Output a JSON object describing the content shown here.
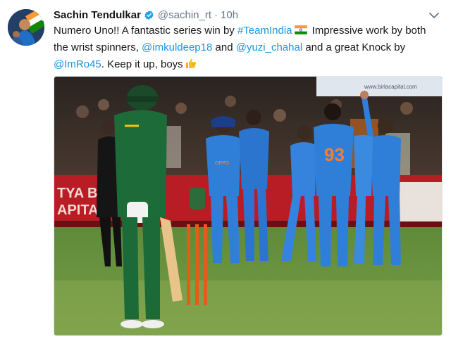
{
  "tweet": {
    "author_name": "Sachin Tendulkar",
    "handle": "@sachin_rt",
    "separator": "·",
    "timestamp": "10h",
    "line1_a": "Numero Uno!! A fantastic series win by ",
    "hashtag": "#TeamIndia",
    "line1_b": " Impressive work by both",
    "line2_a": "the wrist spinners, ",
    "mention1": "@imkuldeep18",
    "line2_b": " and ",
    "mention2": "@yuzi_chahal",
    "line2_c": " and a great Knock by",
    "mention3": "@ImRo45",
    "line3_b": ". Keep it up, boys",
    "photo": {
      "banner_left": "TYA BIRL\nAPITA",
      "banner_right": "www.birlacapital.com",
      "jersey_number": "93",
      "sponsor": "OPPO"
    }
  },
  "colors": {
    "link": "#1b95e0",
    "verified": "#1da1f2",
    "india_blue": "#2f7fd8",
    "sa_green": "#1e6b3a",
    "banner_red": "#c8202a"
  },
  "icons": [
    "verified-badge-icon",
    "chevron-down-icon",
    "india-flag-emoji",
    "thumbs-up-emoji"
  ]
}
